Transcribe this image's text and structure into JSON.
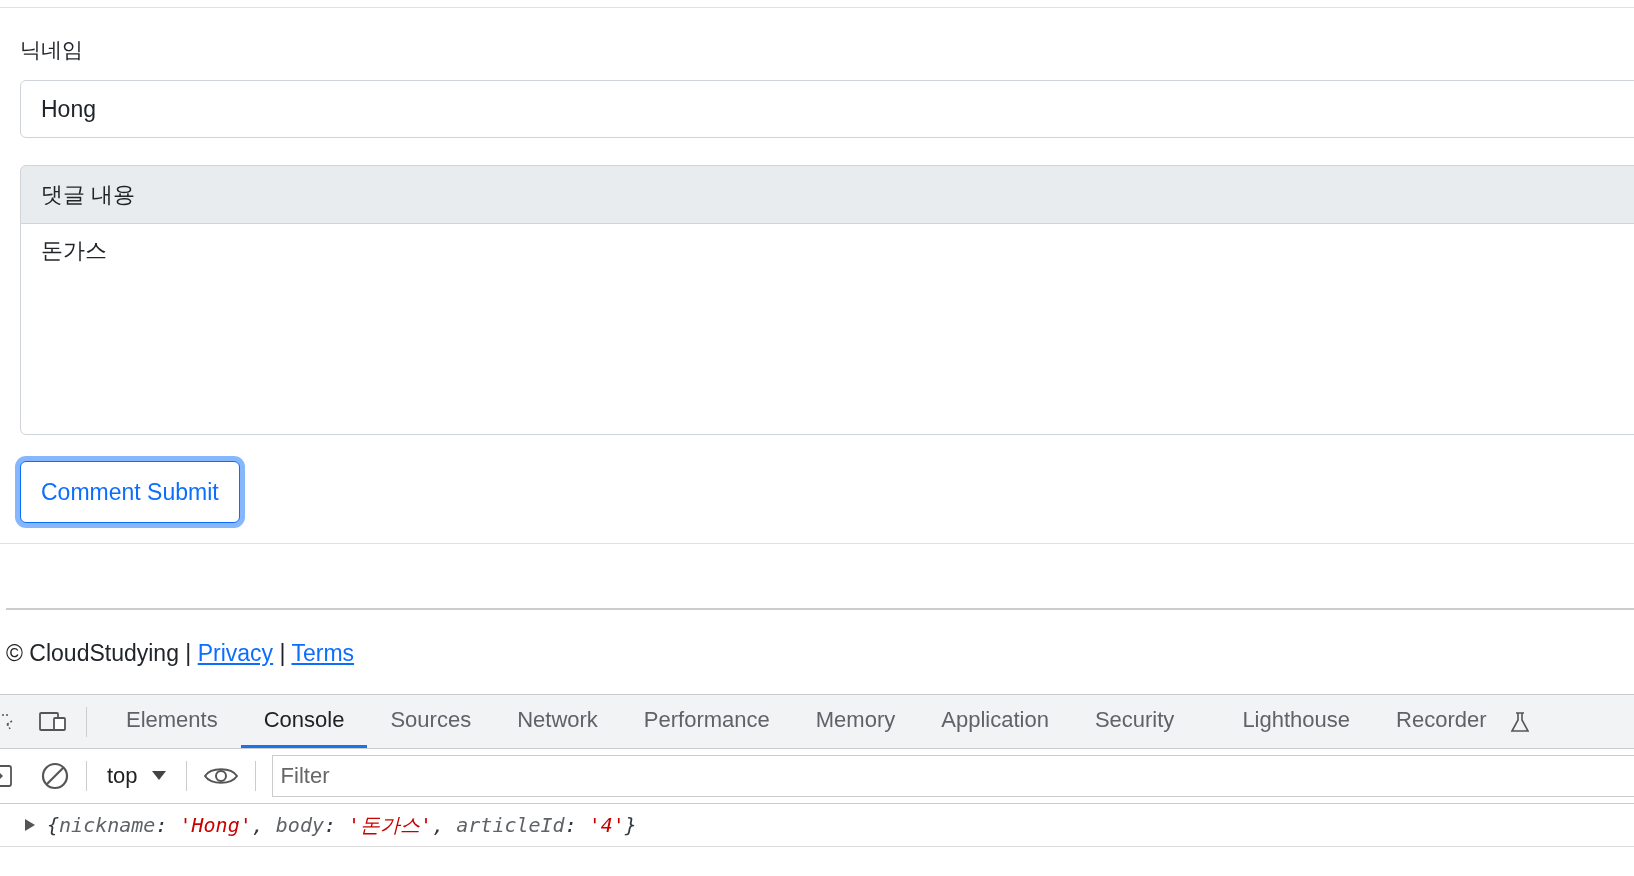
{
  "form": {
    "nickname_label": "닉네임",
    "nickname_value": "Hong",
    "body_label": "댓글 내용",
    "body_value": "돈가스",
    "submit": {
      "label": "Comment Submit",
      "focused": true
    }
  },
  "footer": {
    "text_before": "© CloudStudying |",
    "links": [
      {
        "label": "Privacy"
      },
      {
        "label": "Terms"
      }
    ],
    "separator": "|"
  },
  "devtools": {
    "tabs": [
      {
        "label": "Elements",
        "selected": false
      },
      {
        "label": "Console",
        "selected": true
      },
      {
        "label": "Sources",
        "selected": false
      },
      {
        "label": "Network",
        "selected": false
      },
      {
        "label": "Performance",
        "selected": false
      },
      {
        "label": "Memory",
        "selected": false
      },
      {
        "label": "Application",
        "selected": false
      },
      {
        "label": "Security",
        "selected": false
      },
      {
        "label": "Lighthouse",
        "selected": false
      },
      {
        "label": "Recorder",
        "selected": false
      }
    ],
    "context": "top",
    "filter": {
      "placeholder": "Filter"
    },
    "log": [
      {
        "text": "{",
        "kind": "punct"
      },
      {
        "text": "nickname",
        "kind": "key"
      },
      {
        "text": ": ",
        "kind": "punct"
      },
      {
        "text": "'Hong'",
        "kind": "string"
      },
      {
        "text": ", ",
        "kind": "punct"
      },
      {
        "text": "body",
        "kind": "key"
      },
      {
        "text": ": ",
        "kind": "punct"
      },
      {
        "text": "'돈가스'",
        "kind": "string"
      },
      {
        "text": ", ",
        "kind": "punct"
      },
      {
        "text": "articleId",
        "kind": "key"
      },
      {
        "text": ": ",
        "kind": "punct"
      },
      {
        "text": "'4'",
        "kind": "string"
      },
      {
        "text": "}",
        "kind": "punct"
      }
    ]
  }
}
